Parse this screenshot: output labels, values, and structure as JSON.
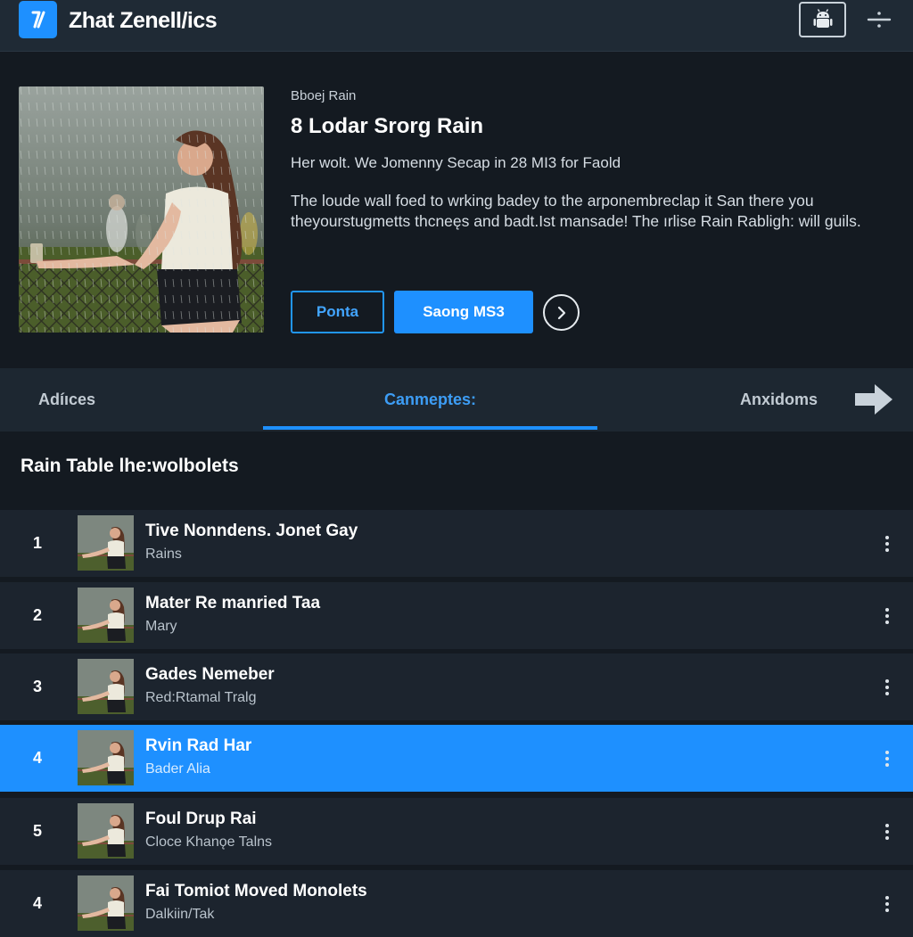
{
  "app": {
    "title": "Zhat Zenell/ics",
    "logo_icon": "logo-slash-icon",
    "accent": "#1e90ff"
  },
  "top_actions": {
    "android_icon": "android-icon",
    "more_icon": "overflow-menu-icon"
  },
  "hero": {
    "kicker": "Bboej Rain",
    "title": "8 Lodar Srorg Rain",
    "meta": "Her wolt. We Jomenny Secap in 28 MI3 for Faold",
    "description": "The loude wall foed to wrking badey to the arponembreclap it San there you theyourstugmetts thcneęs and badt.Ist mansade! The ırlise Rain Rabligh: will guils.",
    "button_outline": "Ponta",
    "button_primary": "Saong MS3",
    "next_icon": "chevron-right-icon"
  },
  "tabs": [
    {
      "label": "Adíıces"
    },
    {
      "label": "Canmeptes:"
    },
    {
      "label": "Anxidoms"
    }
  ],
  "tabs_arrow_icon": "arrow-right-icon",
  "section": {
    "title": "Rain Table lhe:wolbolets"
  },
  "tracks": [
    {
      "num": "1",
      "title": "Tive Nonndens. Jonet Gay",
      "subtitle": "Rains"
    },
    {
      "num": "2",
      "title": "Mater Re manried Taa",
      "subtitle": "Mary"
    },
    {
      "num": "3",
      "title": "Gades Nemeber",
      "subtitle": "Red:Rtamal Tralg"
    },
    {
      "num": "4",
      "title": "Rvin Rad Har",
      "subtitle": "Bader Alia",
      "selected": true
    },
    {
      "num": "5",
      "title": "Foul Drup Rai",
      "subtitle": "Cloce Khanǫe Talns"
    },
    {
      "num": "4",
      "title": "Fai Tomiot Moved Monolets",
      "subtitle": "Dalkiin/Tak"
    }
  ],
  "colors": {
    "background": "#141a21",
    "row": "#1c242e",
    "selected_row": "#1e90ff",
    "tab_active": "#3d9df5"
  }
}
